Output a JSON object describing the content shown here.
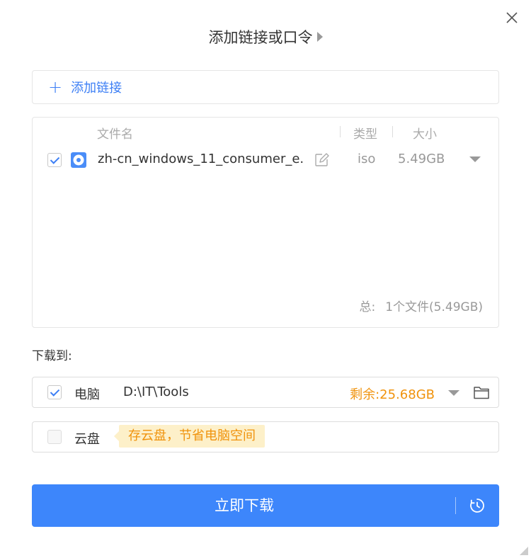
{
  "dialog": {
    "title": "添加链接或口令"
  },
  "add_link": {
    "label": "添加链接"
  },
  "file_list": {
    "headers": {
      "name": "文件名",
      "type": "类型",
      "size": "大小"
    },
    "files": [
      {
        "name": "zh-cn_windows_11_consumer_e...",
        "type": "iso",
        "size": "5.49GB",
        "checked": true
      }
    ],
    "total_label": "总:",
    "total_value": "1个文件(5.49GB)"
  },
  "download_to": {
    "label": "下载到:",
    "pc": {
      "label": "电脑",
      "path": "D:\\IT\\Tools",
      "free": "剩余:25.68GB",
      "checked": true
    },
    "cloud": {
      "label": "云盘",
      "tip": "存云盘，节省电脑空间",
      "checked": false
    }
  },
  "download_button": {
    "label": "立即下载"
  },
  "colors": {
    "accent": "#3d86fb",
    "link": "#3d7ff5",
    "warning": "#f0930d",
    "tip_bg": "#fdf0c9"
  },
  "icons": [
    "close-icon",
    "play-triangle-icon",
    "plus-icon",
    "disc-icon",
    "edit-icon",
    "chevron-down-icon",
    "folder-icon",
    "timer-icon",
    "resize-grip-icon"
  ]
}
